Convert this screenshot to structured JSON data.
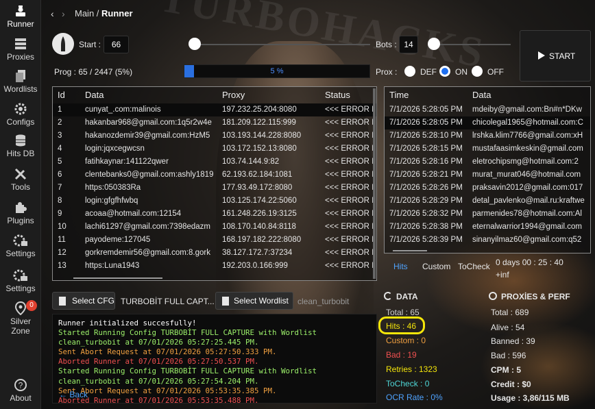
{
  "sidebar": {
    "items": [
      {
        "label": "Runner",
        "icon": "runner-icon"
      },
      {
        "label": "Proxies",
        "icon": "server-icon"
      },
      {
        "label": "Wordlists",
        "icon": "files-icon"
      },
      {
        "label": "Configs",
        "icon": "gear-icon"
      },
      {
        "label": "Hits DB",
        "icon": "database-icon"
      },
      {
        "label": "Tools",
        "icon": "tools-icon"
      },
      {
        "label": "Plugins",
        "icon": "puzzle-icon"
      },
      {
        "label": "Settings",
        "icon": "gear-sb-icon"
      },
      {
        "label": "Settings",
        "icon": "gear-core-icon"
      },
      {
        "label": "Silver Zone",
        "icon": "location-icon",
        "badge": "0"
      },
      {
        "label": "About",
        "icon": "help-icon"
      }
    ]
  },
  "header": {
    "crumb_main": "Main /",
    "crumb_current": "Runner"
  },
  "controls": {
    "start_label": "Start :",
    "start_value": "66",
    "bots_label": "Bots :",
    "bots_value": "14",
    "start_button": "START",
    "prog_text": "Prog : 65 / 2447 (5%)",
    "progress_percent": 5,
    "progress_text": "5 %",
    "prox_label": "Prox :",
    "prox_options": [
      "DEF",
      "ON",
      "OFF"
    ],
    "prox_selected": "ON"
  },
  "data_table": {
    "headers": [
      "Id",
      "Data",
      "Proxy",
      "Status"
    ],
    "rows": [
      {
        "id": "1",
        "data": "cunyat_.com:malinois",
        "proxy": "197.232.25.204:8080",
        "status": "<<< ERROR I"
      },
      {
        "id": "2",
        "data": "hakanbar968@gmail.com:1q5r2w4e",
        "proxy": "181.209.122.115:999",
        "status": "<<< ERROR I"
      },
      {
        "id": "3",
        "data": "hakanozdemir39@gmail.com:HzM5",
        "proxy": "103.193.144.228:8080",
        "status": "<<< ERROR I"
      },
      {
        "id": "4",
        "data": "login:jqxcegwcsn",
        "proxy": "103.172.152.13:8080",
        "status": "<<< ERROR I"
      },
      {
        "id": "5",
        "data": "fatihkaynar:141122qwer",
        "proxy": "103.74.144.9:82",
        "status": "<<< ERROR I"
      },
      {
        "id": "6",
        "data": "clentebanks0@gmail.com:ashly1819",
        "proxy": "62.193.62.184:1081",
        "status": "<<< ERROR I"
      },
      {
        "id": "7",
        "data": "https:050383Ra",
        "proxy": "177.93.49.172:8080",
        "status": "<<< ERROR I"
      },
      {
        "id": "8",
        "data": "login:gfgfhfwbq",
        "proxy": "103.125.174.22:5060",
        "status": "<<< ERROR I"
      },
      {
        "id": "9",
        "data": "acoaa@hotmail.com:12154",
        "proxy": "161.248.226.19:3125",
        "status": "<<< ERROR I"
      },
      {
        "id": "10",
        "data": "lachi61297@gmail.com:7398edazm",
        "proxy": "108.170.140.84:8118",
        "status": "<<< ERROR I"
      },
      {
        "id": "11",
        "data": "payodeme:127045",
        "proxy": "168.197.182.222:8080",
        "status": "<<< ERROR I"
      },
      {
        "id": "12",
        "data": "gorkremdemir56@gmail.com:8.gork",
        "proxy": "38.127.172.7:37234",
        "status": "<<< ERROR I"
      },
      {
        "id": "13",
        "data": "https:Luna1943",
        "proxy": "192.203.0.166:999",
        "status": "<<< ERROR I"
      }
    ]
  },
  "hits_table": {
    "headers": [
      "Time",
      "Data"
    ],
    "rows": [
      {
        "time": "7/1/2026 5:28:05 PM",
        "data": "mdeiby@gmail.com:Bn#n*DKw"
      },
      {
        "time": "7/1/2026 5:28:05 PM",
        "data": "chicolegal1965@hotmail.com:C"
      },
      {
        "time": "7/1/2026 5:28:10 PM",
        "data": "lrshka.klim7766@gmail.com:xH"
      },
      {
        "time": "7/1/2026 5:28:15 PM",
        "data": "mustafaasimkeskin@gmail.com"
      },
      {
        "time": "7/1/2026 5:28:16 PM",
        "data": "eletrochipsmg@hotmail.com:2"
      },
      {
        "time": "7/1/2026 5:28:21 PM",
        "data": "murat_murat046@hotmail.com"
      },
      {
        "time": "7/1/2026 5:28:26 PM",
        "data": "praksavin2012@gmail.com:017"
      },
      {
        "time": "7/1/2026 5:28:29 PM",
        "data": "detal_pavlenko@mail.ru:kraftwe"
      },
      {
        "time": "7/1/2026 5:28:32 PM",
        "data": "parmenides78@hotmail.com:Al"
      },
      {
        "time": "7/1/2026 5:28:38 PM",
        "data": "eternalwarrior1994@gmail.com"
      },
      {
        "time": "7/1/2026 5:28:39 PM",
        "data": "sinanyilmaz60@gmail.com:q52"
      }
    ]
  },
  "hits_tabs": [
    "Hits",
    "Custom",
    "ToCheck"
  ],
  "elapsed": "0 days 00 : 25 : 40",
  "cpm_rate": "+inf",
  "cfg": {
    "select_cfg": "Select CFG",
    "cfg_name": "TURBOBİT FULL CAPT...",
    "select_wordlist": "Select Wordlist",
    "wordlist_name": "clean_turbobit"
  },
  "data_stats": {
    "title": "DATA",
    "total": "Total : 65",
    "hits": "Hits : 46",
    "custom": "Custom : 0",
    "bad": "Bad : 19",
    "retries": "Retries : 1323",
    "tocheck": "ToCheck : 0",
    "ocr": "OCR Rate : 0%"
  },
  "proxy_stats": {
    "title": "PROXİES & PERF",
    "total": "Total : 689",
    "alive": "Alive : 54",
    "banned": "Banned : 39",
    "bad": "Bad : 596",
    "cpm": "CPM : 5",
    "credit": "Credit : $0",
    "usage": "Usage : 3,86/115 MB"
  },
  "log": [
    {
      "text": "Runner initialized succesfully!",
      "color": "#ffffff"
    },
    {
      "text": "Started Running Config TURBOBİT FULL CAPTURE with Wordlist",
      "color": "#9cf06a"
    },
    {
      "text": "clean_turbobit at 07/01/2026 05:27:25.445 PM.",
      "color": "#9cf06a"
    },
    {
      "text": "Sent Abort Request at 07/01/2026 05:27:50.333 PM.",
      "color": "#f0a040"
    },
    {
      "text": "Aborted Runner at 07/01/2026 05:27:50.537 PM.",
      "color": "#f05050"
    },
    {
      "text": "Started Running Config TURBOBİT FULL CAPTURE with Wordlist",
      "color": "#9cf06a"
    },
    {
      "text": "clean_turbobit at 07/01/2026 05:27:54.204 PM.",
      "color": "#9cf06a"
    },
    {
      "text": "Sent Abort Request at 07/01/2026 05:53:35.385 PM.",
      "color": "#f0a040"
    },
    {
      "text": "Aborted Runner at 07/01/2026 05:53:35.488 PM.",
      "color": "#f05050"
    }
  ],
  "back_label": "Back",
  "colors": {
    "accent": "#2a6fe0",
    "highlight": "#f5e60a",
    "hits": "#f5e60a",
    "custom": "#f0a040",
    "bad": "#f05050",
    "retries": "#f5e60a",
    "tocheck": "#4fd7d7",
    "ocr": "#4fa3ff"
  }
}
